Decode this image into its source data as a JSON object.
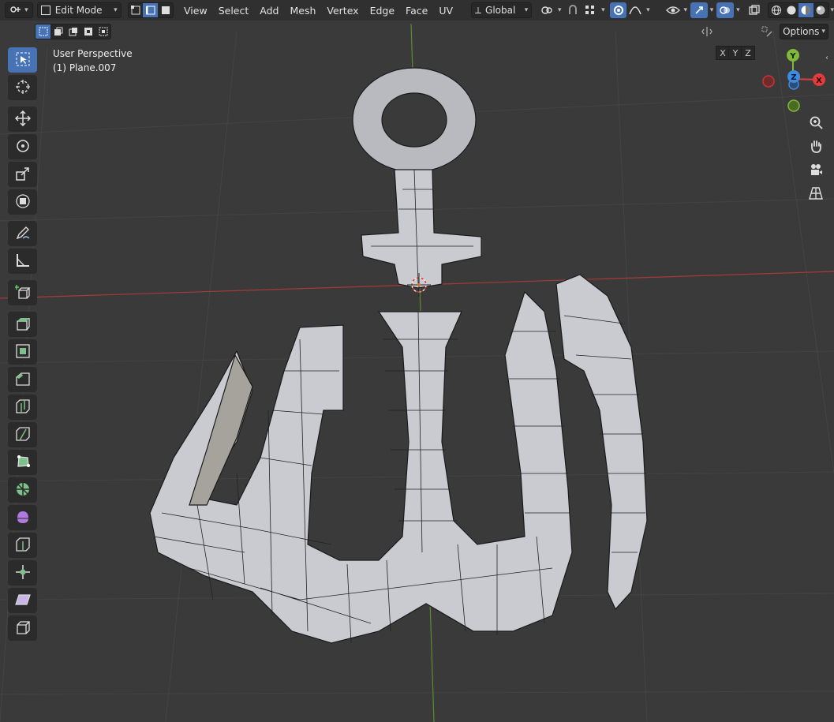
{
  "header": {
    "editor_type_icon": "object-icon",
    "mode": "Edit Mode",
    "select_modes": [
      "vertex",
      "edge",
      "face"
    ],
    "menus": [
      "View",
      "Select",
      "Add",
      "Mesh",
      "Vertex",
      "Edge",
      "Face",
      "UV"
    ],
    "orientation": "Global"
  },
  "subheader": {
    "axis_x": "X",
    "axis_y": "Y",
    "axis_z": "Z",
    "options": "Options"
  },
  "viewport": {
    "perspective_label": "User Perspective",
    "object_label": "(1) Plane.007"
  },
  "gizmo": {
    "y": "Y",
    "z": "Z",
    "x": "X"
  },
  "colors": {
    "accent": "#4772b3",
    "grid_bg": "#3a3a3a",
    "x_axis": "#e03c3c",
    "y_axis": "#80b83a",
    "z_axis": "#3c8de0",
    "mesh": "#c8cad0"
  },
  "toolbar_tools": [
    "select-box",
    "cursor",
    "move",
    "rotate",
    "scale",
    "transform",
    "annotate",
    "measure",
    "add-cube",
    "extrude",
    "inset",
    "bevel",
    "loop-cut",
    "knife",
    "poly-build",
    "spin",
    "smooth",
    "edge-slide",
    "shrink-fatten",
    "shear",
    "rip-region"
  ]
}
